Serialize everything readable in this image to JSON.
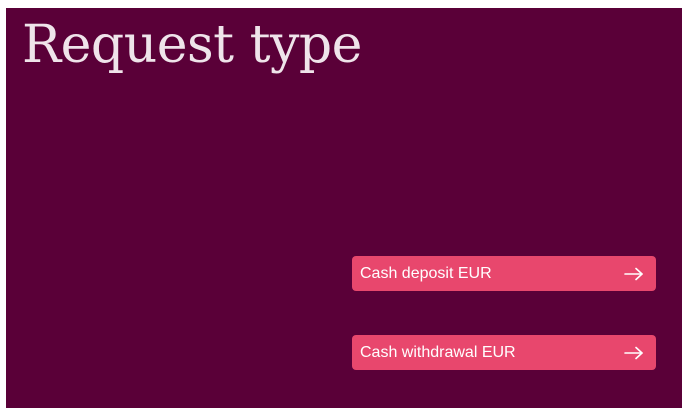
{
  "screen": {
    "title": "Request type",
    "background_color": "#5a0038",
    "accent_color": "#e8476d"
  },
  "options": [
    {
      "label": "Cash deposit EUR",
      "icon": "arrow-right-icon"
    },
    {
      "label": "Cash withdrawal EUR",
      "icon": "arrow-right-icon"
    }
  ]
}
